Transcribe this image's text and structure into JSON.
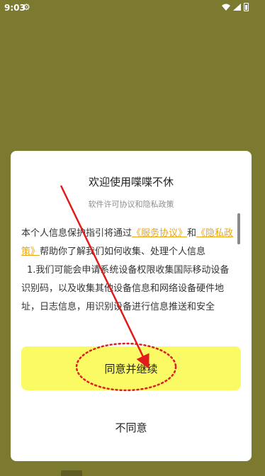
{
  "status_bar": {
    "time": "9:03",
    "icons": [
      "gear-icon",
      "wifi-icon",
      "signal-icon",
      "battery-icon"
    ]
  },
  "dialog": {
    "title": "欢迎使用喋喋不休",
    "subtitle": "软件许可协议和隐私政策",
    "body": {
      "p1_prefix": "本个人信息保护指引将通过",
      "link_service": "《服务协议》",
      "p1_and": "和",
      "link_privacy": "《隐私政策》",
      "p1_suffix": "帮助你了解我们如何收集、处理个人信息",
      "p2": "1.我们可能会申请系统设备权限收集国际移动设备识别码，以及收集其他设备信息和网络设备硬件地址，日志信息，用识别设备进行信息推送和安全"
    },
    "agree_label": "同意并继续",
    "decline_label": "不同意"
  },
  "colors": {
    "background": "#7c7a2f",
    "accent_button": "#fafa64",
    "link": "#e6a817",
    "annotation": "#e01b1b"
  }
}
